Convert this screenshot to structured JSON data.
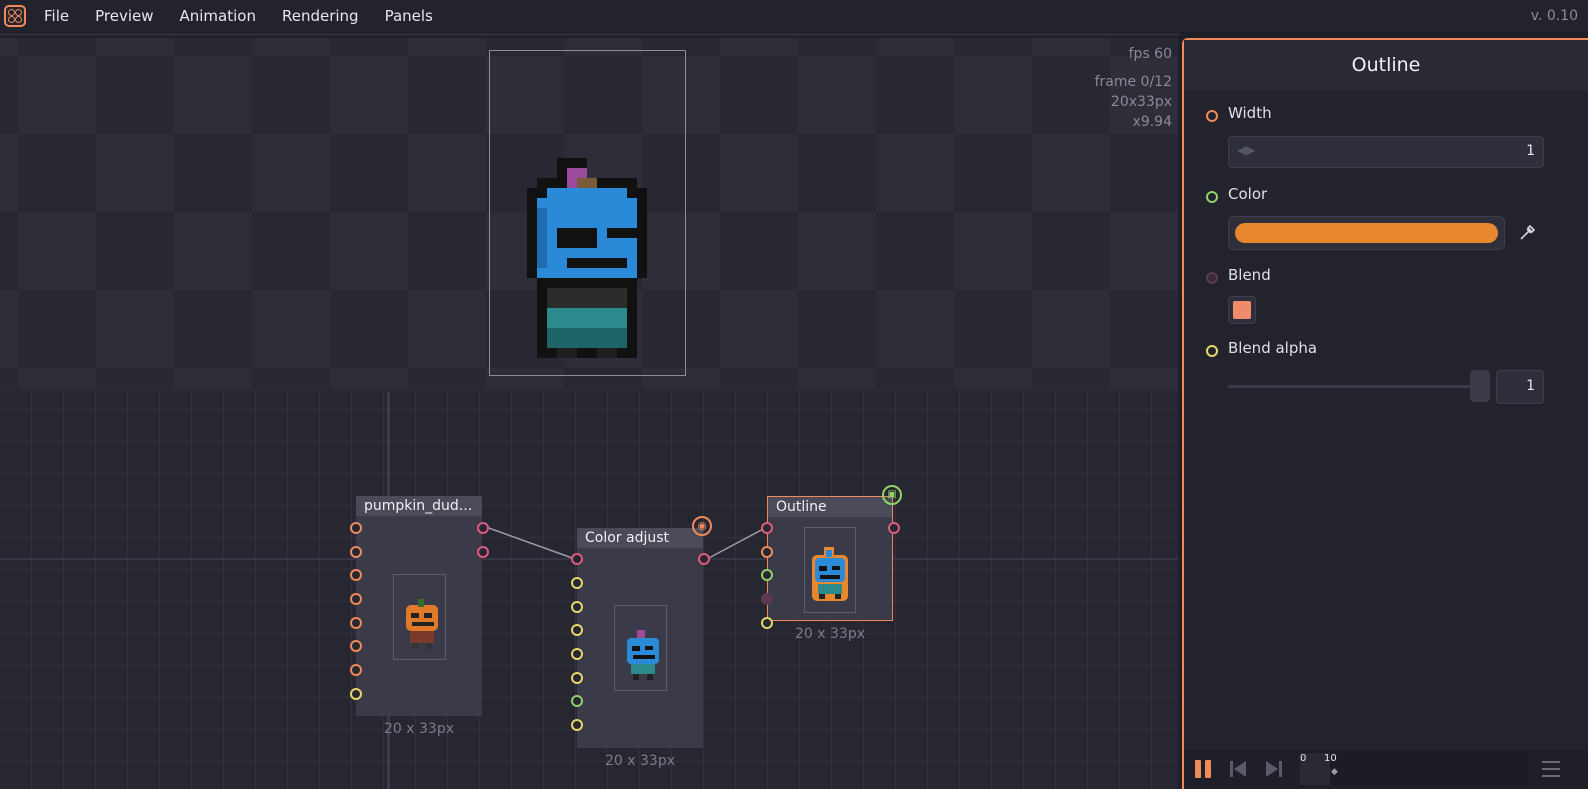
{
  "menu": {
    "items": [
      "File",
      "Preview",
      "Animation",
      "Rendering",
      "Panels"
    ],
    "version": "v. 0.10"
  },
  "preview": {
    "fps": "fps 60",
    "frame": "frame 0/12",
    "size": "20x33px",
    "zoom": "x9.94"
  },
  "graph": {
    "nodes": [
      {
        "title": "pumpkin_dud...",
        "size": "20 x 33px"
      },
      {
        "title": "Color adjust",
        "size": "20 x 33px"
      },
      {
        "title": "Outline",
        "size": "20 x 33px"
      }
    ]
  },
  "inspector": {
    "title": "Outline",
    "width_label": "Width",
    "width_value": "1",
    "color_label": "Color",
    "blend_label": "Blend",
    "blend_alpha_label": "Blend alpha",
    "blend_alpha_value": "1",
    "blend_alpha_level": 1
  },
  "timeline": {
    "marker_0": "0",
    "marker_10": "10"
  },
  "colors": {
    "accent": "#ef8a5b",
    "outline_color": "#e8872e",
    "blend_color": "#f08a6a",
    "character_blue": "#2a8ad8",
    "character_teal": "#2c7a7c"
  },
  "icons": [
    "app-logo-icon",
    "eye-icon",
    "output-icon",
    "eyedropper-icon",
    "pause-icon",
    "previous-frame-icon",
    "next-frame-icon",
    "menu-icon"
  ]
}
